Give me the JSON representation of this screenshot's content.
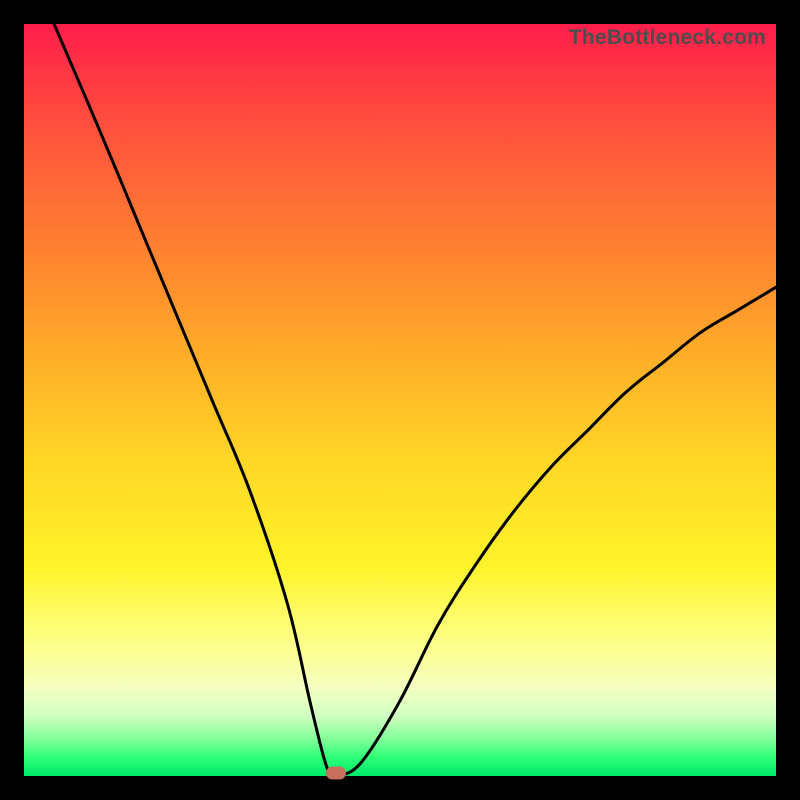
{
  "watermark": "TheBottleneck.com",
  "chart_data": {
    "type": "line",
    "title": "",
    "xlabel": "",
    "ylabel": "",
    "xlim": [
      0,
      100
    ],
    "ylim": [
      0,
      100
    ],
    "grid": false,
    "legend": false,
    "series": [
      {
        "name": "curve",
        "x": [
          4,
          10,
          15,
          20,
          25,
          30,
          35,
          38,
          40,
          41,
          42,
          45,
          50,
          55,
          60,
          65,
          70,
          75,
          80,
          85,
          90,
          95,
          100
        ],
        "y": [
          100,
          86,
          74,
          62,
          50,
          38,
          23,
          10,
          2,
          0,
          0,
          2,
          10,
          20,
          28,
          35,
          41,
          46,
          51,
          55,
          59,
          62,
          65
        ]
      }
    ],
    "marker": {
      "x": 41.5,
      "y": 0
    }
  },
  "colors": {
    "curve": "#000000",
    "marker": "#c96e5e",
    "background_top": "#ff1e4a",
    "background_bottom": "#00e96a"
  }
}
